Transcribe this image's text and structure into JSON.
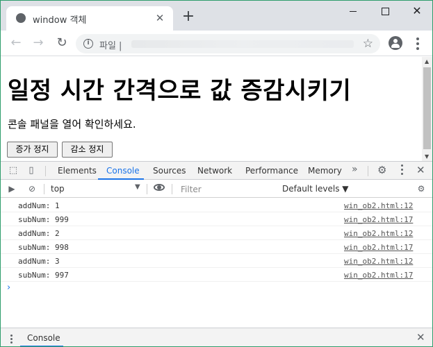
{
  "browser": {
    "tab_title": "window 객체",
    "tab_close": "✕",
    "new_tab": "+",
    "omnibox_scheme": "파일 |",
    "icons": [
      "globe-icon",
      "back-icon",
      "forward-icon",
      "reload-icon",
      "info-icon",
      "star-icon",
      "profile-icon",
      "menu-icon"
    ]
  },
  "page": {
    "heading": "일정 시간 간격으로 값 증감시키기",
    "instruction": "콘솔 패널을 열어 확인하세요.",
    "buttons": [
      "증가 정지",
      "감소 정지"
    ]
  },
  "devtools": {
    "tabs": [
      "Elements",
      "Console",
      "Sources",
      "Network",
      "Performance",
      "Memory"
    ],
    "active_tab": "Console",
    "more": "»",
    "context": "top",
    "filter_placeholder": "Filter",
    "levels": "Default levels ▼",
    "logs": [
      {
        "msg": "addNum: 1",
        "src": "win_ob2.html:12"
      },
      {
        "msg": "subNum: 999",
        "src": "win_ob2.html:17"
      },
      {
        "msg": "addNum: 2",
        "src": "win_ob2.html:12"
      },
      {
        "msg": "subNum: 998",
        "src": "win_ob2.html:17"
      },
      {
        "msg": "addNum: 3",
        "src": "win_ob2.html:12"
      },
      {
        "msg": "subNum: 997",
        "src": "win_ob2.html:17"
      }
    ],
    "prompt": "›",
    "drawer_tab": "Console"
  },
  "colors": {
    "accent": "#1a73e8",
    "window_border": "#2e9d6c",
    "tabstrip": "#dee1e6"
  }
}
